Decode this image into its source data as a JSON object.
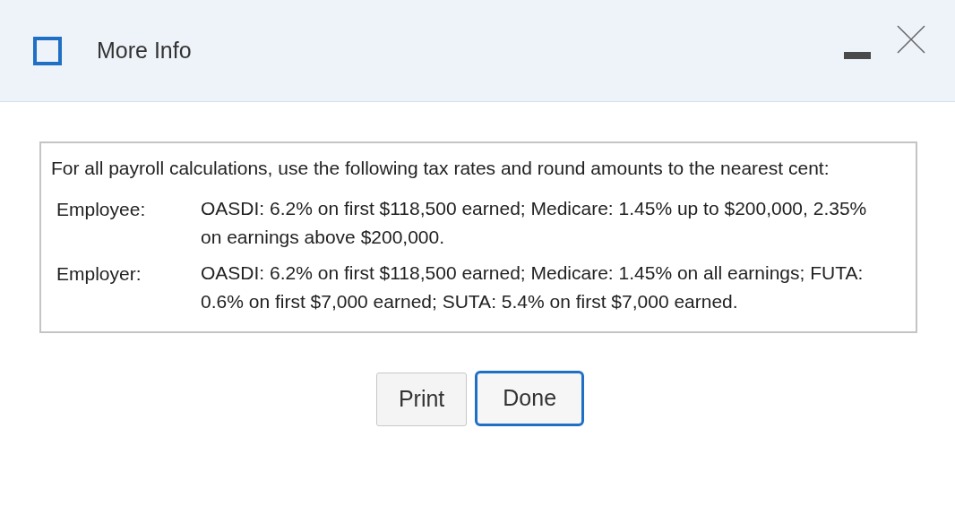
{
  "window": {
    "title": "More Info"
  },
  "info": {
    "intro": "For all payroll calculations, use the following tax rates and round amounts to the nearest cent:",
    "rows": [
      {
        "label": "Employee:",
        "text": "OASDI: 6.2% on first $118,500 earned; Medicare: 1.45% up to $200,000, 2.35% on earnings above $200,000."
      },
      {
        "label": "Employer:",
        "text": "OASDI: 6.2% on first $118,500 earned; Medicare: 1.45% on all earnings; FUTA: 0.6% on first $7,000 earned; SUTA: 5.4% on first $7,000 earned."
      }
    ]
  },
  "buttons": [
    {
      "label": "Print",
      "focused": false
    },
    {
      "label": "Done",
      "focused": true
    }
  ]
}
